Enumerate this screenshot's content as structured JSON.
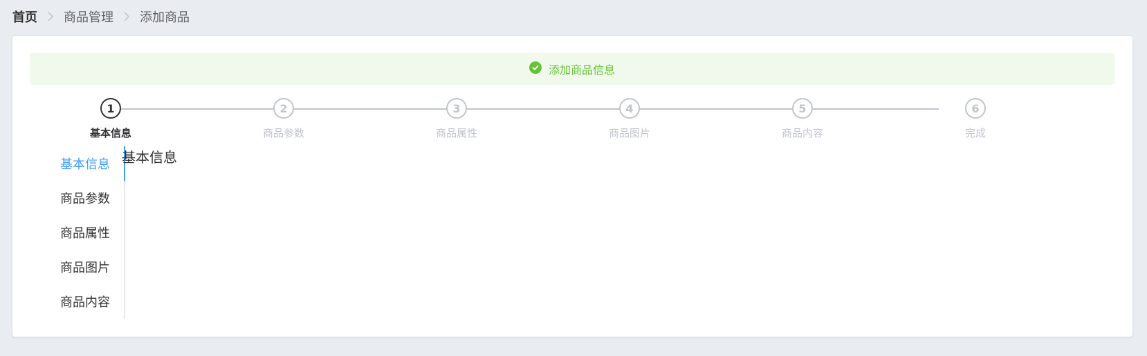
{
  "breadcrumb": {
    "items": [
      "首页",
      "商品管理",
      "添加商品"
    ]
  },
  "alert": {
    "text": "添加商品信息",
    "icon": "check-circle-icon",
    "color": "#67c23a"
  },
  "steps": {
    "active": 0,
    "items": [
      {
        "number": "1",
        "label": "基本信息"
      },
      {
        "number": "2",
        "label": "商品参数"
      },
      {
        "number": "3",
        "label": "商品属性"
      },
      {
        "number": "4",
        "label": "商品图片"
      },
      {
        "number": "5",
        "label": "商品内容"
      },
      {
        "number": "6",
        "label": "完成"
      }
    ]
  },
  "tabs": {
    "active": 0,
    "items": [
      "基本信息",
      "商品参数",
      "商品属性",
      "商品图片",
      "商品内容"
    ],
    "active_color": "#409eff"
  },
  "pane": {
    "title": "基本信息"
  }
}
